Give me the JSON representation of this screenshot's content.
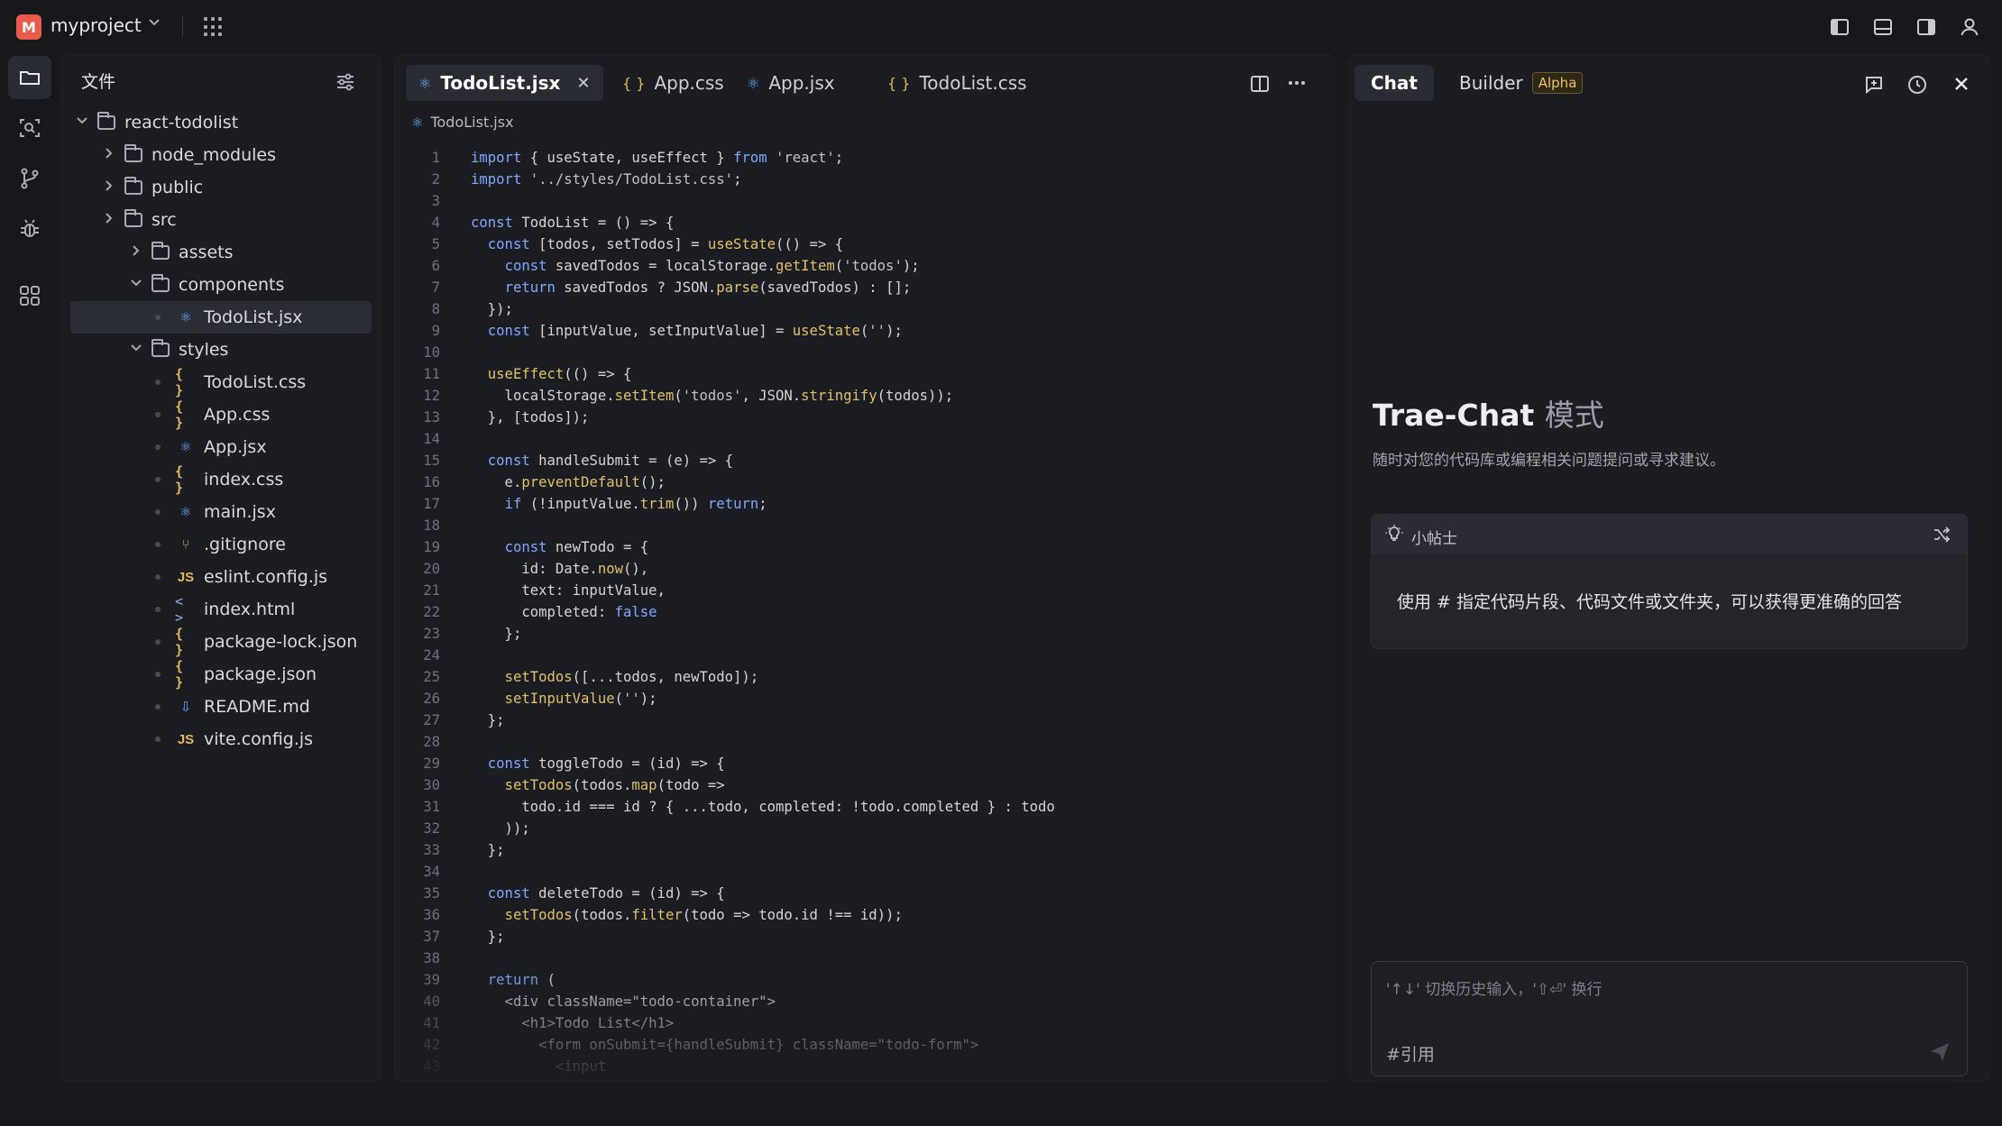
{
  "titlebar": {
    "badge": "M",
    "project": "myproject",
    "chevron": "⌄"
  },
  "explorer": {
    "title": "文件",
    "items": [
      {
        "label": "react-todolist",
        "level": 0,
        "type": "folder",
        "expanded": true
      },
      {
        "label": "node_modules",
        "level": 1,
        "type": "folder",
        "expanded": false
      },
      {
        "label": "public",
        "level": 1,
        "type": "folder",
        "expanded": false
      },
      {
        "label": "src",
        "level": 1,
        "type": "folder",
        "expanded": false
      },
      {
        "label": "assets",
        "level": 2,
        "type": "folder",
        "expanded": false
      },
      {
        "label": "components",
        "level": 2,
        "type": "folder",
        "expanded": true
      },
      {
        "label": "TodoList.jsx",
        "level": 3,
        "type": "react",
        "selected": true
      },
      {
        "label": "styles",
        "level": 2,
        "type": "folder",
        "expanded": true
      },
      {
        "label": "TodoList.css",
        "level": 3,
        "type": "css"
      },
      {
        "label": "App.css",
        "level": 3,
        "type": "css"
      },
      {
        "label": "App.jsx",
        "level": 3,
        "type": "react"
      },
      {
        "label": "index.css",
        "level": 3,
        "type": "css"
      },
      {
        "label": "main.jsx",
        "level": 3,
        "type": "react"
      },
      {
        "label": ".gitignore",
        "level": 3,
        "type": "git"
      },
      {
        "label": "eslint.config.js",
        "level": 3,
        "type": "js"
      },
      {
        "label": "index.html",
        "level": 3,
        "type": "html"
      },
      {
        "label": "package-lock.json",
        "level": 3,
        "type": "css"
      },
      {
        "label": "package.json",
        "level": 3,
        "type": "css"
      },
      {
        "label": "README.md",
        "level": 3,
        "type": "md"
      },
      {
        "label": "vite.config.js",
        "level": 3,
        "type": "js"
      }
    ]
  },
  "editor": {
    "tabs": [
      {
        "label": "TodoList.jsx",
        "type": "react",
        "active": true
      },
      {
        "label": "App.css",
        "type": "css"
      },
      {
        "label": "App.jsx",
        "type": "react"
      },
      {
        "label": "TodoList.css",
        "type": "css"
      }
    ],
    "breadcrumb": "TodoList.jsx",
    "lines": [
      "import { useState, useEffect } from 'react';",
      "import '../styles/TodoList.css';",
      "",
      "const TodoList = () => {",
      "  const [todos, setTodos] = useState(() => {",
      "    const savedTodos = localStorage.getItem('todos');",
      "    return savedTodos ? JSON.parse(savedTodos) : [];",
      "  });",
      "  const [inputValue, setInputValue] = useState('');",
      "",
      "  useEffect(() => {",
      "    localStorage.setItem('todos', JSON.stringify(todos));",
      "  }, [todos]);",
      "",
      "  const handleSubmit = (e) => {",
      "    e.preventDefault();",
      "    if (!inputValue.trim()) return;",
      "",
      "    const newTodo = {",
      "      id: Date.now(),",
      "      text: inputValue,",
      "      completed: false",
      "    };",
      "",
      "    setTodos([...todos, newTodo]);",
      "    setInputValue('');",
      "  };",
      "",
      "  const toggleTodo = (id) => {",
      "    setTodos(todos.map(todo =>",
      "      todo.id === id ? { ...todo, completed: !todo.completed } : todo",
      "    ));",
      "  };",
      "",
      "  const deleteTodo = (id) => {",
      "    setTodos(todos.filter(todo => todo.id !== id));",
      "  };",
      "",
      "  return (",
      "    <div className=\"todo-container\">",
      "      <h1>Todo List</h1>",
      "        <form onSubmit={handleSubmit} className=\"todo-form\">",
      "          <input"
    ]
  },
  "chat": {
    "tab_chat": "Chat",
    "tab_builder": "Builder",
    "badge_alpha": "Alpha",
    "title_main": "Trae-Chat",
    "title_mode": "模式",
    "subtitle": "随时对您的代码库或编程相关问题提问或寻求建议。",
    "tip_label": "小帖士",
    "tip_text": "使用 # 指定代码片段、代码文件或文件夹，可以获得更准确的回答",
    "input_placeholder": "'↑↓' 切换历史输入，'⇧⏎' 换行",
    "input_ref": "#引用"
  }
}
